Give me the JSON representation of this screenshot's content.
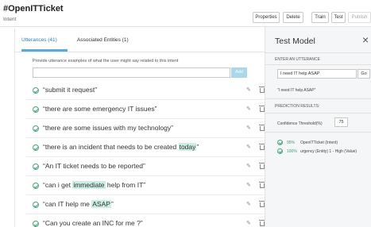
{
  "header": {
    "title": "#OpenITTicket",
    "subtitle": "Intent",
    "buttons": {
      "properties": "Properties",
      "delete": "Delete",
      "train": "Train",
      "test": "Test",
      "publish": "Publish"
    }
  },
  "tabs": {
    "utterances": "Utterances (41)",
    "entities": "Associated Entities (1)"
  },
  "utterances": {
    "instruction": "Provide utterance examples of what the user might say related to this intent",
    "input_value": "",
    "add_label": "Add",
    "items": [
      {
        "pre": "“submit it request”",
        "hl": "",
        "post": ""
      },
      {
        "pre": "“there are some emergency IT issues”",
        "hl": "",
        "post": ""
      },
      {
        "pre": "“there are some issues with my technology”",
        "hl": "",
        "post": ""
      },
      {
        "pre": "“there is an incident that needs to be created ",
        "hl": "today",
        "post": "”"
      },
      {
        "pre": "“An IT ticket needs to be reported”",
        "hl": "",
        "post": ""
      },
      {
        "pre": "“can i get ",
        "hl": "immediate",
        "post": " help from IT”"
      },
      {
        "pre": "“can IT help me ",
        "hl": "ASAP",
        "post": "”"
      },
      {
        "pre": "“Can you create an INC for me ?”",
        "hl": "",
        "post": ""
      }
    ]
  },
  "test_model": {
    "title": "Test Model",
    "close_icon": "×",
    "enter_label": "ENTER AN UTTERANCE",
    "input_value": "I need IT help ASAP",
    "go_label": "Go",
    "echo": "“I need IT help ASAP”",
    "results_label": "PREDICTION RESULTS:",
    "confidence_label": "Confidence Threshold(%)",
    "confidence_value": "75",
    "predictions": [
      {
        "pct": "95%",
        "text": "OpenITTicket (Intent)"
      },
      {
        "pct": "100%",
        "text": "urgency (Entity) 1 - High (Value)"
      }
    ]
  },
  "colors": {
    "accent": "#2a7fb8",
    "highlight": "#cdeee5",
    "success": "#46a67a",
    "add_button": "#a8d8ea"
  }
}
